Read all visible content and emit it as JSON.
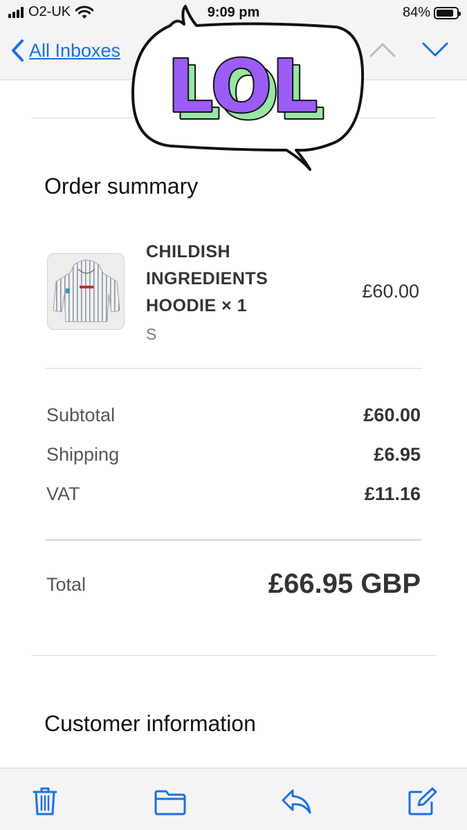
{
  "status_bar": {
    "carrier": "O2-UK",
    "time": "9:09 pm",
    "battery_percent": "84%",
    "battery_level": 0.84
  },
  "nav": {
    "back_label": "All Inboxes"
  },
  "sticker": {
    "text": "LOL",
    "colors": {
      "face": "#9b5cf6",
      "side": "#98e6a4",
      "outline": "#111111"
    }
  },
  "order_summary": {
    "title": "Order summary",
    "item": {
      "name_lines": [
        "CHILDISH",
        "INGREDIENTS",
        "HOODIE × 1"
      ],
      "variant": "S",
      "price": "£60.00"
    },
    "costs": [
      {
        "label": "Subtotal",
        "value": "£60.00"
      },
      {
        "label": "Shipping",
        "value": "£6.95"
      },
      {
        "label": "VAT",
        "value": "£11.16"
      }
    ],
    "total_label": "Total",
    "total_value": "£66.95 GBP"
  },
  "customer_info": {
    "title": "Customer information"
  },
  "toolbar": {
    "icons": [
      "trash-icon",
      "folder-icon",
      "reply-icon",
      "compose-icon"
    ]
  },
  "accent_color": "#1a6fe0"
}
